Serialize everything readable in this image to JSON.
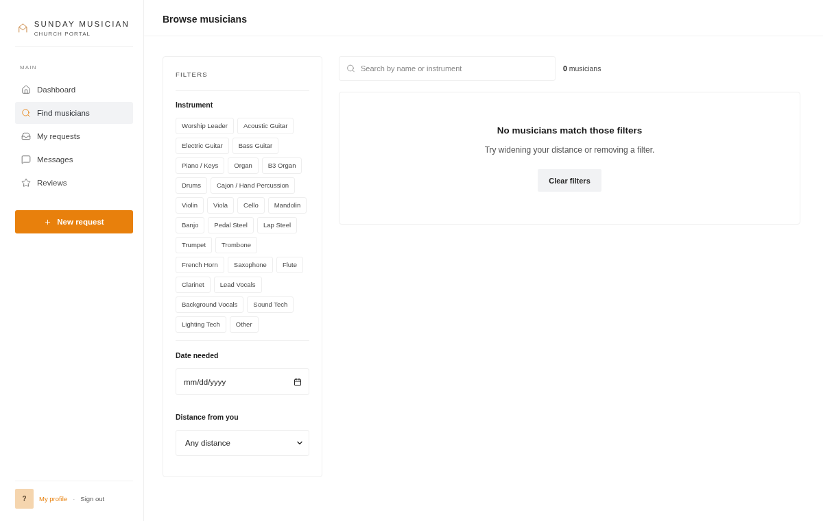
{
  "brand": {
    "name": "SUNDAY MUSICIAN",
    "tagline": "CHURCH PORTAL"
  },
  "sidebar": {
    "section_label": "MAIN",
    "items": [
      {
        "label": "Dashboard",
        "selected": false
      },
      {
        "label": "Find musicians",
        "selected": true
      },
      {
        "label": "My requests",
        "selected": false
      },
      {
        "label": "Messages",
        "selected": false
      },
      {
        "label": "Reviews",
        "selected": false
      }
    ],
    "new_request_button": "New request",
    "footer": {
      "avatar": "?",
      "profile_link": "My profile",
      "separator": "·",
      "sign_out_link": "Sign out"
    }
  },
  "header": {
    "title": "Browse musicians"
  },
  "filters": {
    "title": "FILTERS",
    "instrument": {
      "label": "Instrument",
      "chips": [
        {
          "label": "Worship Leader",
          "selected": false
        },
        {
          "label": "Acoustic Guitar",
          "selected": false
        },
        {
          "label": "Electric Guitar",
          "selected": false
        },
        {
          "label": "Bass Guitar",
          "selected": false
        },
        {
          "label": "Piano / Keys",
          "selected": false
        },
        {
          "label": "Organ",
          "selected": false
        },
        {
          "label": "B3 Organ",
          "selected": false
        },
        {
          "label": "Drums",
          "selected": false
        },
        {
          "label": "Cajon / Hand Percussion",
          "selected": false
        },
        {
          "label": "Violin",
          "selected": false
        },
        {
          "label": "Viola",
          "selected": false
        },
        {
          "label": "Cello",
          "selected": false
        },
        {
          "label": "Mandolin",
          "selected": false
        },
        {
          "label": "Banjo",
          "selected": false
        },
        {
          "label": "Pedal Steel",
          "selected": false
        },
        {
          "label": "Lap Steel",
          "selected": false
        },
        {
          "label": "Trumpet",
          "selected": false
        },
        {
          "label": "Trombone",
          "selected": false
        },
        {
          "label": "French Horn",
          "selected": false
        },
        {
          "label": "Saxophone",
          "selected": false
        },
        {
          "label": "Flute",
          "selected": false
        },
        {
          "label": "Clarinet",
          "selected": false
        },
        {
          "label": "Lead Vocals",
          "selected": false
        },
        {
          "label": "Background Vocals",
          "selected": false
        },
        {
          "label": "Sound Tech",
          "selected": false
        },
        {
          "label": "Lighting Tech",
          "selected": false
        },
        {
          "label": "Other",
          "selected": false
        }
      ]
    },
    "date_needed": {
      "label": "Date needed",
      "placeholder": "mm/dd/yyyy"
    },
    "distance": {
      "label": "Distance from you",
      "value": "Any distance"
    }
  },
  "search": {
    "placeholder": "Search by name or instrument"
  },
  "result_count": "**0** musicians",
  "empty_state": {
    "title": "No musicians match those filters",
    "message": "Try widening your distance or removing a filter.",
    "button": "Clear filters"
  }
}
